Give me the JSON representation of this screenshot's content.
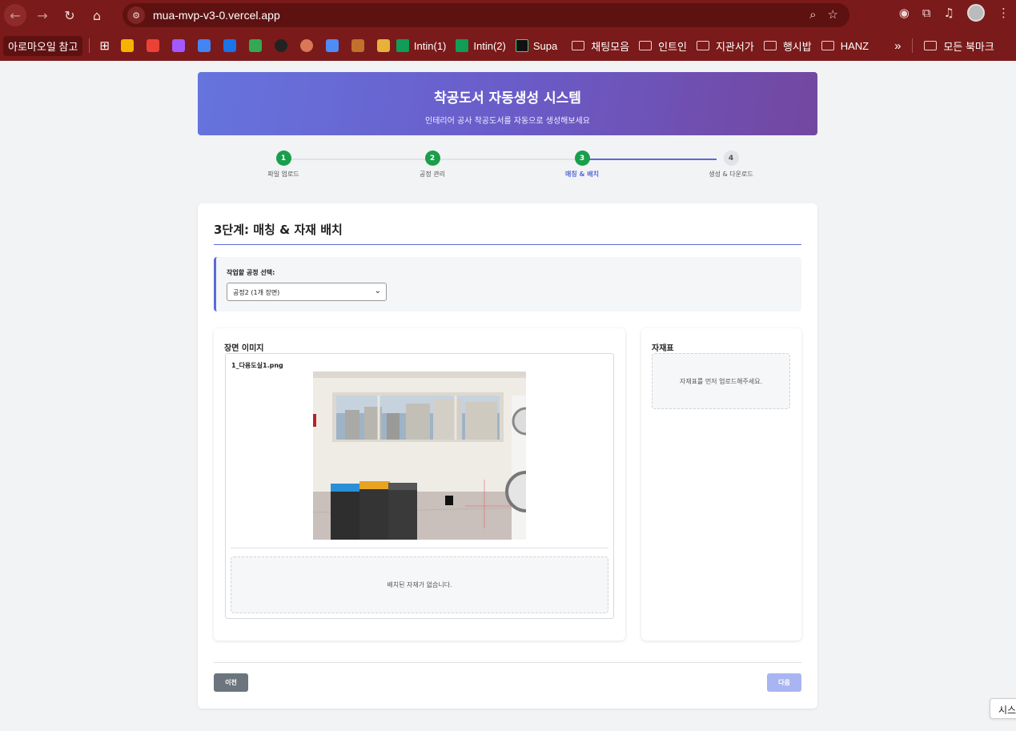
{
  "browser": {
    "url": "mua-mvp-v3-0.vercel.app",
    "bookmarks_first": "아로마오일 참고",
    "bookmarks": [
      {
        "label": "Intin(1)",
        "icon": "sheets-icon"
      },
      {
        "label": "Intin(2)",
        "icon": "sheets-icon"
      },
      {
        "label": "Supa",
        "icon": "supabase-icon"
      }
    ],
    "folders": [
      "채팅모음",
      "인트인",
      "지관서가",
      "행시밥",
      "HANZ"
    ],
    "all_bookmarks": "모든 북마크",
    "overflow": "»"
  },
  "header": {
    "title": "착공도서 자동생성 시스템",
    "subtitle": "인테리어 공사 착공도서를 자동으로 생성해보세요"
  },
  "stepper": {
    "current": 3,
    "steps": [
      {
        "num": "1",
        "label": "파일 업로드"
      },
      {
        "num": "2",
        "label": "공정 관리"
      },
      {
        "num": "3",
        "label": "매칭 & 배치"
      },
      {
        "num": "4",
        "label": "생성 & 다운로드"
      }
    ]
  },
  "step3": {
    "title": "3단계: 매칭 & 자재 배치",
    "select_label": "작업할 공정 선택:",
    "select_value": "공정2 (1개 장면)",
    "scene_panel_title": "장면 이미지",
    "scene_filename": "1_다용도실1.png",
    "scene_empty": "배치된 자재가 없습니다.",
    "materials_title": "자재표",
    "materials_empty": "자재표를 먼저 업로드해주세요.",
    "prev_label": "이전",
    "next_label": "다음"
  },
  "corner_chip": "시스",
  "colors": {
    "chrome": "#7b1a1a",
    "accent": "#5a6bd6",
    "step_done": "#1a9e4b",
    "btn_prev": "#6c757d",
    "btn_next_disabled": "#a9b5f2"
  }
}
